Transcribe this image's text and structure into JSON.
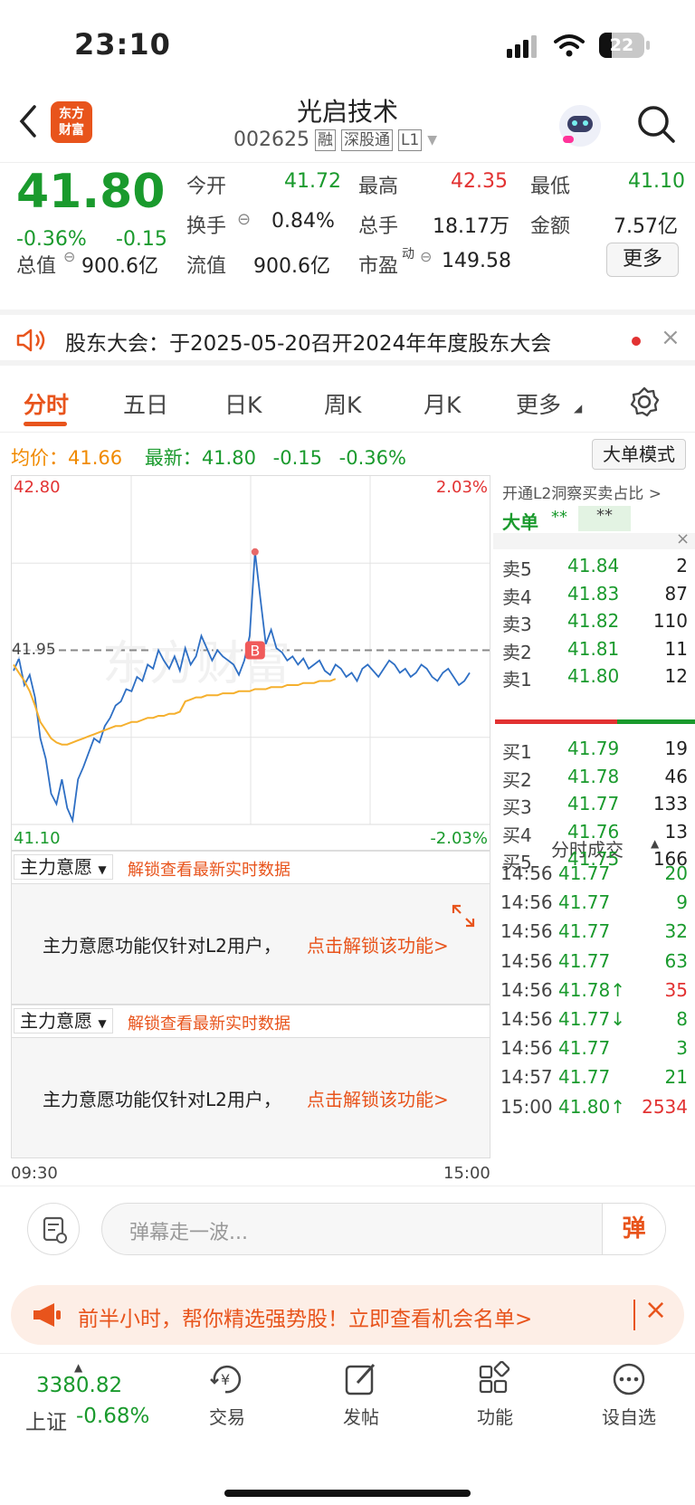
{
  "status_bar": {
    "time": "23:10",
    "battery": "22"
  },
  "header": {
    "title": "光启技术",
    "code": "002625",
    "tag_rong": "融",
    "tag_sgt": "深股通",
    "tag_level": "L1",
    "logo_line1": "东方",
    "logo_line2": "财富"
  },
  "quote": {
    "price": "41.80",
    "change_pct": "-0.36%",
    "change": "-0.15",
    "fields": [
      {
        "label": "今开",
        "value": "41.72"
      },
      {
        "label": "最高",
        "value": "42.35"
      },
      {
        "label": "最低",
        "value": "41.10"
      },
      {
        "label": "换手",
        "value": "0.84%"
      },
      {
        "label": "总手",
        "value": "18.17万"
      },
      {
        "label": "金额",
        "value": "7.57亿"
      },
      {
        "label": "总值",
        "value": "900.6亿"
      },
      {
        "label": "流值",
        "value": "900.6亿"
      },
      {
        "label": "市盈",
        "value": "149.58",
        "sup": "动"
      }
    ],
    "more": "更多"
  },
  "notice": {
    "text": "股东大会：于2025-05-20召开2024年年度股东大会"
  },
  "tabs": [
    "分时",
    "五日",
    "日K",
    "周K",
    "月K",
    "更多"
  ],
  "info_line": {
    "avg_label": "均价：",
    "avg": "41.66",
    "latest_label": "最新：",
    "latest": "41.80",
    "change": "-0.15",
    "pct": "-0.36%",
    "mode_btn": "大单模式"
  },
  "chart": {
    "top": "42.80",
    "bottom": "41.10",
    "top_pct": "2.03%",
    "bottom_pct": "-2.03%",
    "ref": "41.95",
    "start": "09:30",
    "end": "15:00",
    "watermark": "东方财富",
    "marker": "B"
  },
  "chart_data": {
    "type": "line",
    "ylim": [
      41.1,
      42.8
    ],
    "prev_close": 41.95,
    "series": [
      {
        "values": [
          41.85,
          41.91,
          41.78,
          41.83,
          41.72,
          41.52,
          41.42,
          41.25,
          41.2,
          41.32,
          41.18,
          41.12,
          41.32,
          41.38,
          41.45,
          41.52,
          41.5,
          41.58,
          41.62,
          41.68,
          41.7,
          41.76,
          41.75,
          41.82,
          41.8,
          41.88,
          41.86,
          41.95,
          41.9,
          41.86,
          41.92,
          41.85,
          41.96,
          41.88,
          41.92,
          42.02,
          41.96,
          41.9,
          41.95,
          41.92,
          41.9,
          41.88,
          41.83,
          41.9,
          42.02,
          42.43,
          42.2,
          41.98,
          42.05,
          41.96,
          41.94,
          41.9,
          41.92,
          41.88,
          41.91,
          41.86,
          41.88,
          41.9,
          41.85,
          41.83,
          41.88,
          41.86,
          41.82,
          41.84,
          41.8,
          41.86,
          41.88,
          41.85,
          41.82,
          41.86,
          41.9,
          41.88,
          41.84,
          41.86,
          41.82,
          41.84,
          41.88,
          41.86,
          41.82,
          41.8,
          41.84,
          41.86,
          41.82,
          41.78,
          41.8,
          41.84
        ]
      },
      {
        "values": [
          41.88,
          41.84,
          41.8,
          41.75,
          41.68,
          41.6,
          41.56,
          41.52,
          41.5,
          41.49,
          41.49,
          41.5,
          41.51,
          41.52,
          41.53,
          41.54,
          41.55,
          41.56,
          41.57,
          41.58,
          41.58,
          41.59,
          41.6,
          41.6,
          41.61,
          41.62,
          41.62,
          41.63,
          41.63,
          41.64,
          41.64,
          41.65,
          41.7,
          41.71,
          41.72,
          41.72,
          41.73,
          41.73,
          41.73,
          41.74,
          41.74,
          41.74,
          41.75,
          41.75,
          41.75,
          41.76,
          41.76,
          41.76,
          41.77,
          41.77,
          41.77,
          41.78,
          41.78,
          41.78,
          41.79,
          41.79,
          41.79,
          41.8,
          41.8,
          41.8,
          41.81
        ]
      }
    ]
  },
  "panels": [
    {
      "selector": "主力意愿",
      "unlock": "解锁查看最新实时数据",
      "msg": "主力意愿功能仅针对L2用户，",
      "link": "点击解锁该功能>"
    },
    {
      "selector": "主力意愿",
      "unlock": "解锁查看最新实时数据",
      "msg": "主力意愿功能仅针对L2用户，",
      "link": "点击解锁该功能>"
    }
  ],
  "l2": {
    "title": "开通L2洞察买卖占比 >",
    "big": "大单",
    "stars1": "**",
    "stars2": "**"
  },
  "asks": [
    {
      "l": "卖5",
      "p": "41.84",
      "v": "2"
    },
    {
      "l": "卖4",
      "p": "41.83",
      "v": "87"
    },
    {
      "l": "卖3",
      "p": "41.82",
      "v": "110"
    },
    {
      "l": "卖2",
      "p": "41.81",
      "v": "11"
    },
    {
      "l": "卖1",
      "p": "41.80",
      "v": "12"
    }
  ],
  "bids": [
    {
      "l": "买1",
      "p": "41.79",
      "v": "19"
    },
    {
      "l": "买2",
      "p": "41.78",
      "v": "46"
    },
    {
      "l": "买3",
      "p": "41.77",
      "v": "133"
    },
    {
      "l": "买4",
      "p": "41.76",
      "v": "13"
    },
    {
      "l": "买5",
      "p": "41.75",
      "v": "166"
    }
  ],
  "trades_title": "分时成交",
  "trades": [
    {
      "t": "14:56",
      "p": "41.77",
      "v": "20",
      "c": "g"
    },
    {
      "t": "14:56",
      "p": "41.77",
      "v": "9",
      "c": "g"
    },
    {
      "t": "14:56",
      "p": "41.77",
      "v": "32",
      "c": "g"
    },
    {
      "t": "14:56",
      "p": "41.77",
      "v": "63",
      "c": "g"
    },
    {
      "t": "14:56",
      "p": "41.78↑",
      "v": "35",
      "c": "r"
    },
    {
      "t": "14:56",
      "p": "41.77↓",
      "v": "8",
      "c": "g"
    },
    {
      "t": "14:56",
      "p": "41.77",
      "v": "3",
      "c": "g"
    },
    {
      "t": "14:57",
      "p": "41.77",
      "v": "21",
      "c": "g"
    },
    {
      "t": "15:00",
      "p": "41.80↑",
      "v": "2534",
      "c": "r"
    }
  ],
  "comment": {
    "placeholder": "弹幕走一波...",
    "send": "弹"
  },
  "promo": {
    "text": "前半小时，帮你精选强势股！立即查看机会名单>"
  },
  "nav": {
    "index_value": "3380.82",
    "index_name": "上证",
    "index_pct": "-0.68%",
    "items": [
      "交易",
      "发帖",
      "功能",
      "设自选"
    ]
  }
}
